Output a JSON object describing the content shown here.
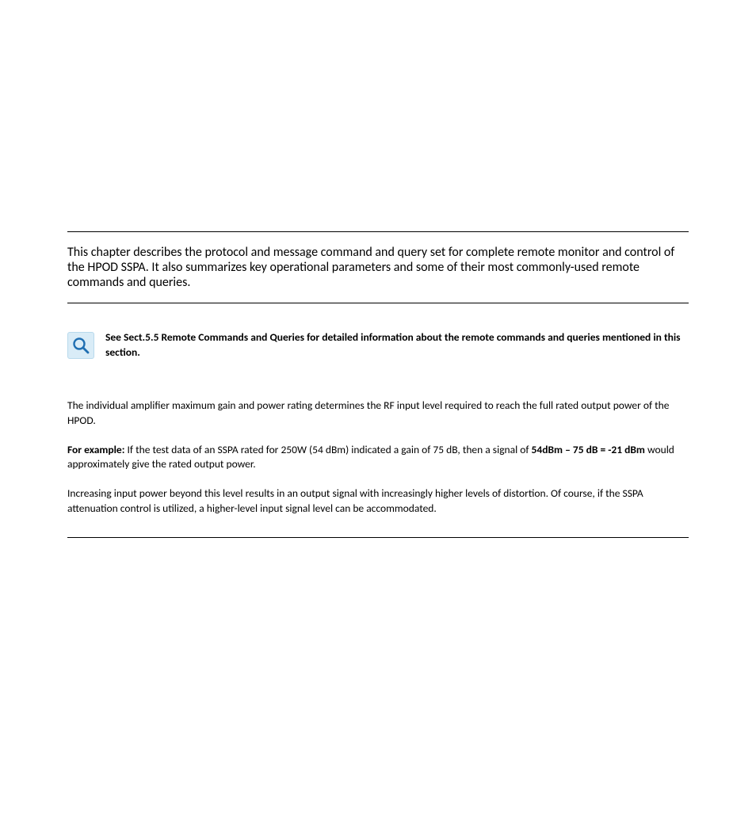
{
  "intro": {
    "paragraph": "This chapter describes the protocol and message command and query set for complete remote monitor and control of the HPOD SSPA. It also summarizes key operational parameters and some of their most commonly-used remote commands and queries."
  },
  "note": {
    "icon_name": "magnifier-icon",
    "text": "See Sect.5.5 Remote Commands and Queries for detailed information about the remote commands and queries mentioned in this section."
  },
  "body": {
    "p1": "The individual amplifier maximum gain and power rating determines the RF input level required to reach the full rated output power of the HPOD.",
    "p2_lead": "For example:",
    "p2_mid": " If the test data of an SSPA rated for 250W (54 dBm) indicated a gain of 75 dB, then a signal of ",
    "p2_bold_calc": "54dBm – 75 dB = -21 dBm",
    "p2_tail": " would approximately give the rated output power.",
    "p3": "Increasing input power beyond this level results in an output signal with increasingly higher levels of distortion. Of course, if the SSPA attenuation control is utilized, a higher-level input signal level can be accommodated."
  }
}
